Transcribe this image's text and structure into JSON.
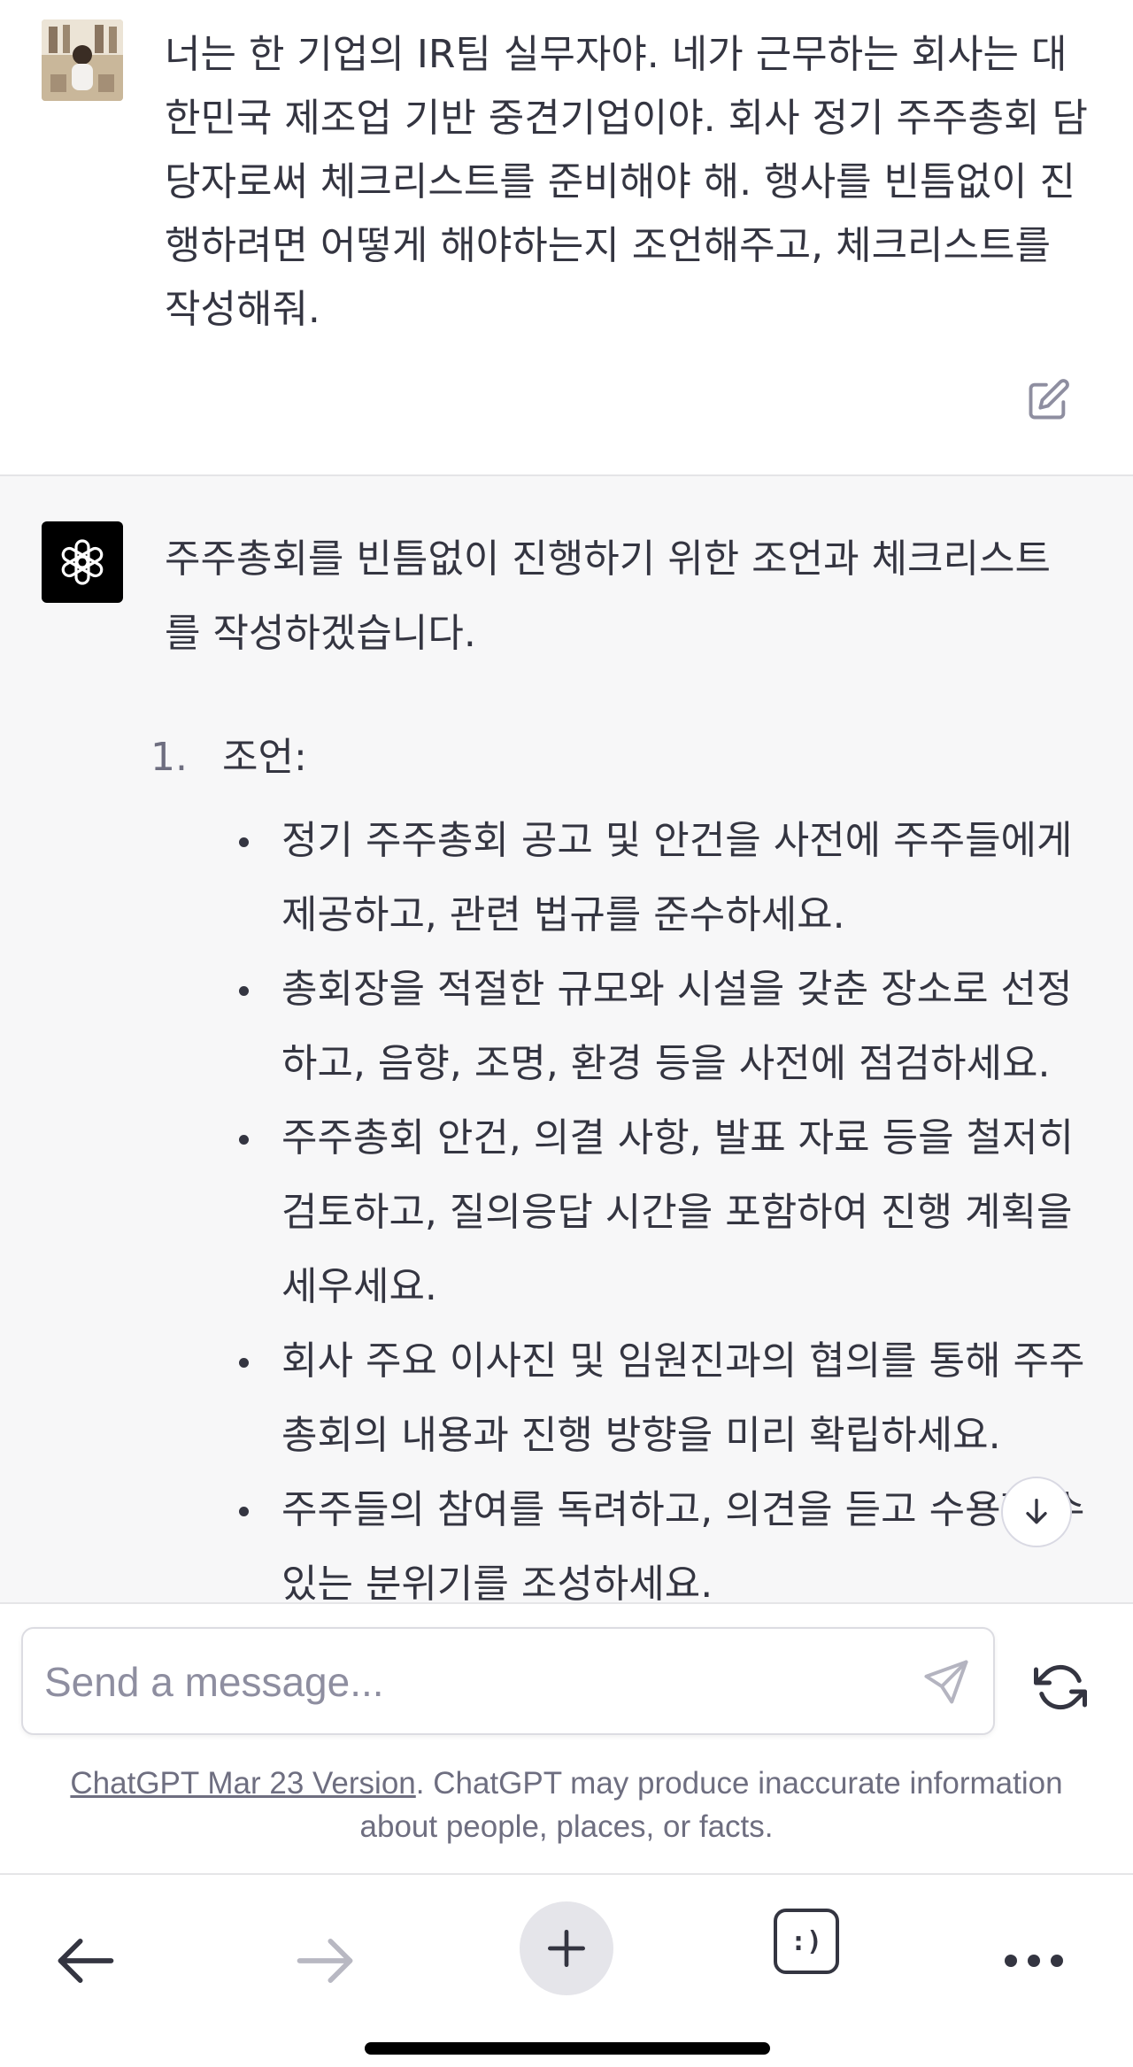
{
  "user_message": {
    "lines": [
      "너는 한 기업의 IR팀 실무자야. 네가 근무하는 회사는 대",
      "한민국 제조업 기반 중견기업이야. 회사 정기 주주총회 담",
      "당자로써 체크리스트를 준비해야 해. 행사를 빈틈없이 진",
      "행하려면 어떻게 해야하는지 조언해주고, 체크리스트를",
      "작성해줘."
    ],
    "edit_icon": "edit-icon"
  },
  "assistant_message": {
    "intro_lines": [
      "주주총회를 빈틈없이 진행하기 위한 조언과 체크리스트",
      "를 작성하겠습니다."
    ],
    "list_number": "1.",
    "list_heading": "조언:",
    "bullets": [
      {
        "lines": [
          "정기 주주총회 공고 및 안건을 사전에 주주들에게",
          "제공하고, 관련 법규를 준수하세요."
        ]
      },
      {
        "lines": [
          "총회장을 적절한 규모와 시설을 갖춘 장소로 선정",
          "하고, 음향, 조명, 환경 등을 사전에 점검하세요."
        ]
      },
      {
        "lines": [
          "주주총회 안건, 의결 사항, 발표 자료 등을 철저히",
          "검토하고, 질의응답 시간을 포함하여 진행 계획을",
          "세우세요."
        ]
      },
      {
        "lines": [
          "회사 주요 이사진 및 임원진과의 협의를 통해 주주",
          "총회의 내용과 진행 방향을 미리 확립하세요."
        ]
      },
      {
        "lines": [
          "주주들의 참여를 독려하고, 의견을 듣고 수용할 수",
          "있는 분위기를 조성하세요."
        ]
      }
    ]
  },
  "composer": {
    "placeholder": "Send a message...",
    "send_icon": "send-icon",
    "regenerate_icon": "refresh-icon"
  },
  "disclaimer": {
    "link_text": "ChatGPT Mar 23 Version",
    "rest_line1": ". ChatGPT may produce inaccurate information",
    "line2": "about people, places, or facts."
  },
  "browser_toolbar": {
    "items": [
      "back-arrow-icon",
      "forward-arrow-icon",
      "new-tab-plus-icon",
      "tabs-icon",
      "more-icon"
    ],
    "tabs_glyph": ":)"
  },
  "colors": {
    "assistant_bg": "#f7f7f8",
    "text": "#343541",
    "muted": "#6e6e80",
    "gpt_avatar_bg": "#000000"
  }
}
